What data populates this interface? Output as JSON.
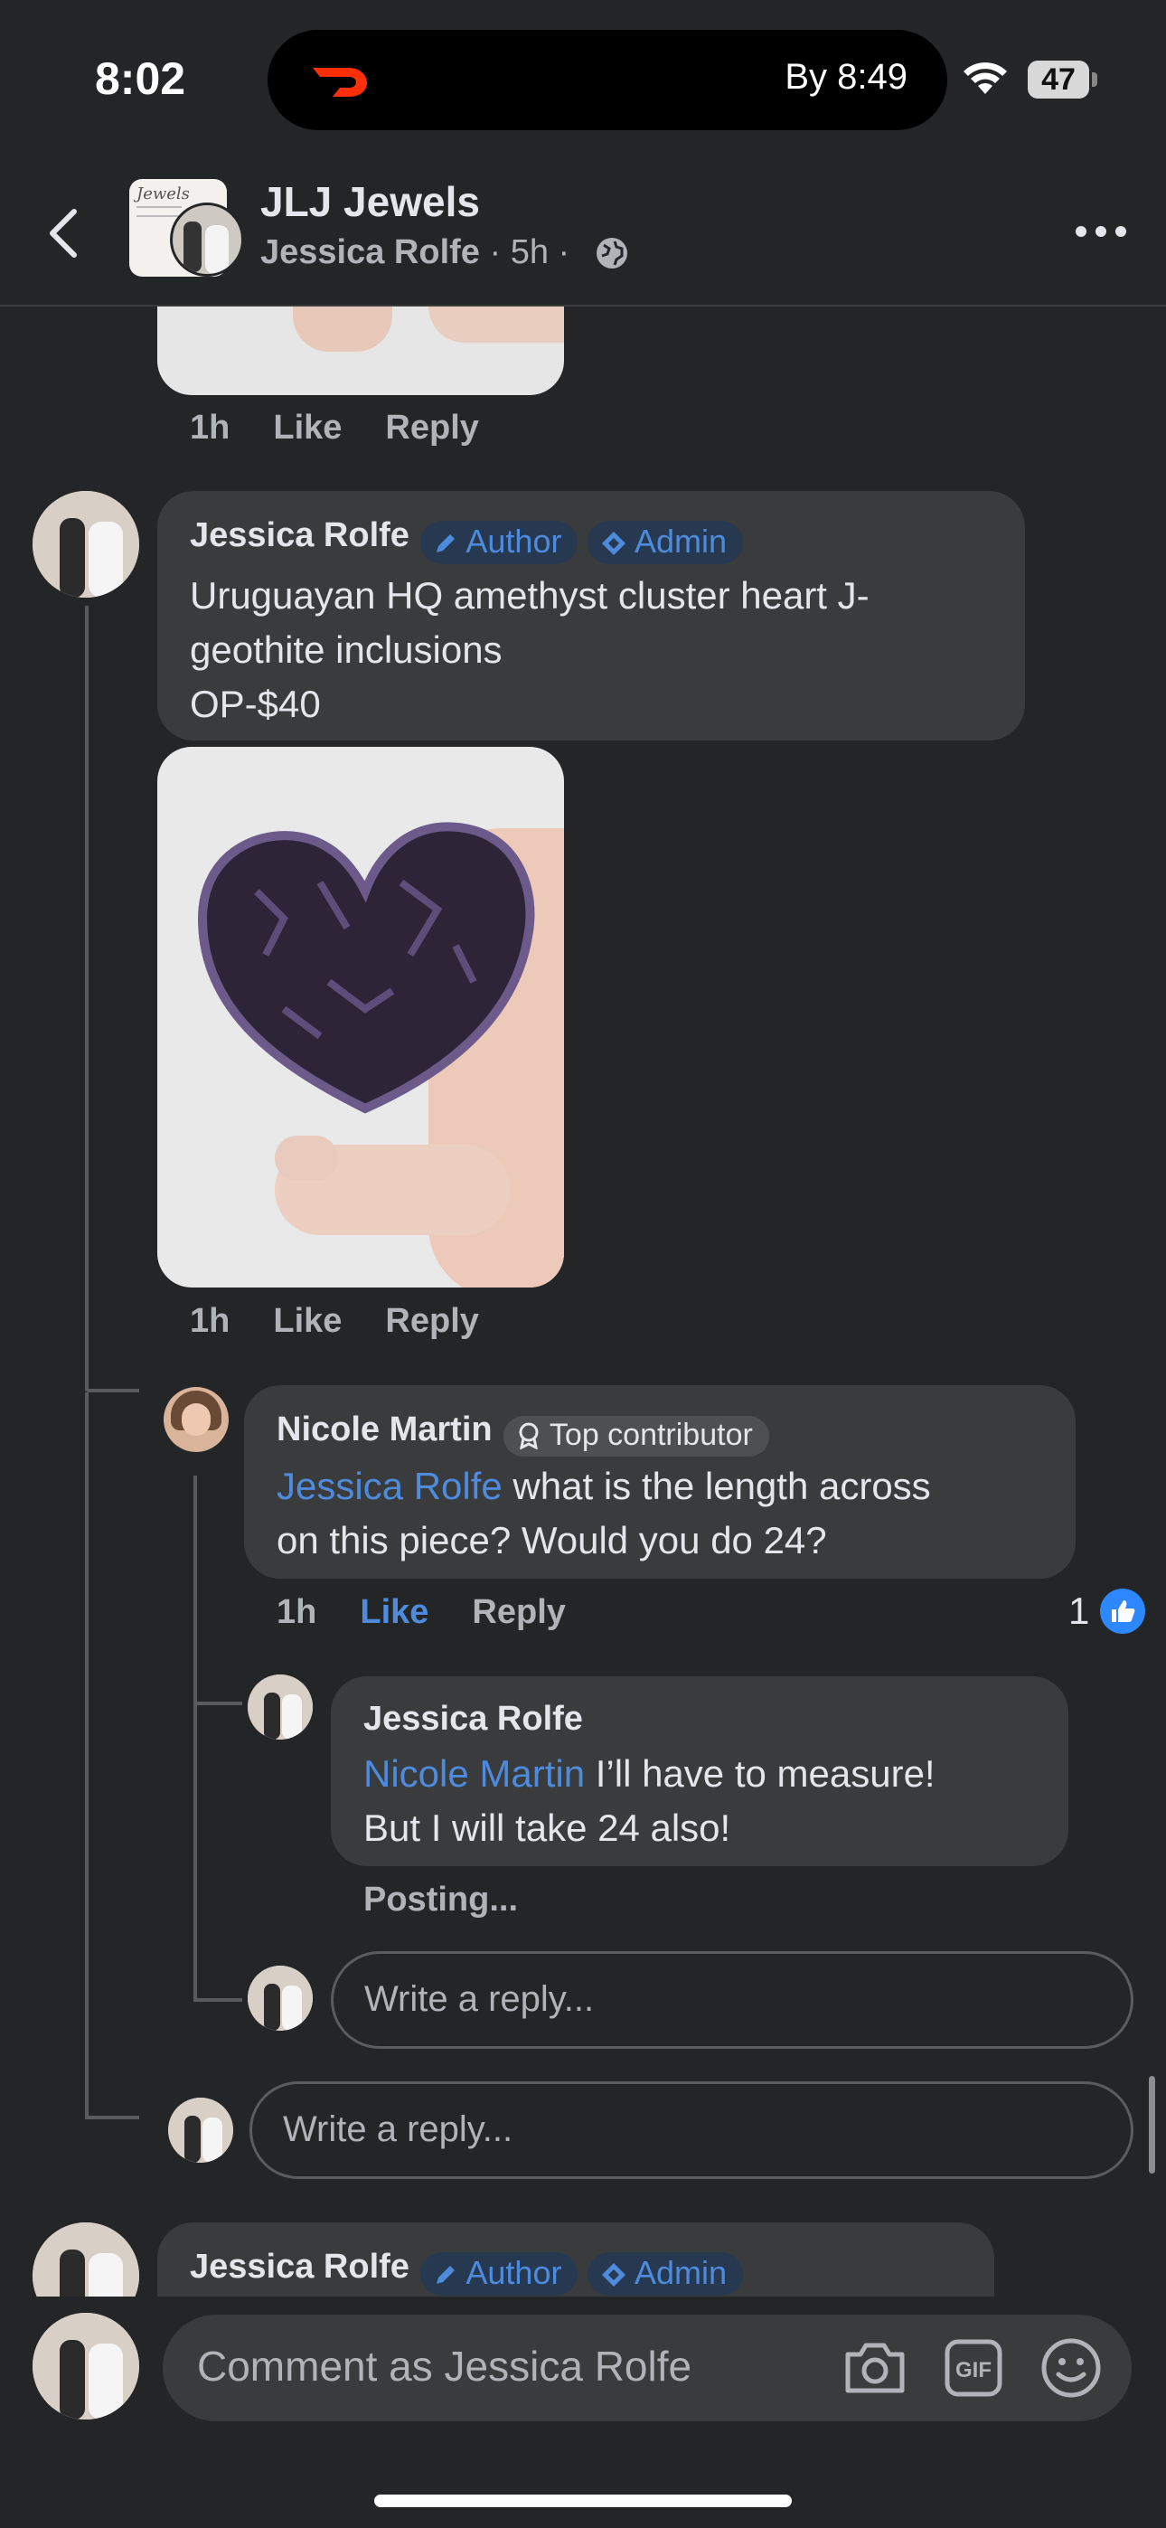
{
  "status": {
    "time": "8:02",
    "eta": "By 8:49",
    "battery": "47"
  },
  "header": {
    "group_name": "JLJ Jewels",
    "author": "Jessica Rolfe",
    "time": "5h"
  },
  "top_comment_actions": {
    "time": "1h",
    "like": "Like",
    "reply": "Reply"
  },
  "main_comment": {
    "author": "Jessica Rolfe",
    "badge_author": "Author",
    "badge_admin": "Admin",
    "text_line1": "Uruguayan HQ amethyst cluster heart J-",
    "text_line2": "geothite inclusions",
    "text_line3": "OP-$40",
    "time": "1h",
    "like": "Like",
    "reply": "Reply"
  },
  "reply1": {
    "author": "Nicole Martin",
    "badge": "Top contributor",
    "mention": "Jessica Rolfe",
    "text_line1": " what is the length across",
    "text_line2": "on this piece? Would you do 24?",
    "time": "1h",
    "like": "Like",
    "reply": "Reply",
    "reactions": "1"
  },
  "reply2": {
    "author": "Jessica Rolfe",
    "mention": "Nicole Martin",
    "text_line1": " I’ll have to measure!",
    "text_line2": "But I will take 24 also!",
    "status": "Posting..."
  },
  "reply_input_nested": {
    "placeholder": "Write a reply..."
  },
  "reply_input_thread": {
    "placeholder": "Write a reply..."
  },
  "next_comment": {
    "author": "Jessica Rolfe",
    "badge_author": "Author",
    "badge_admin": "Admin"
  },
  "composer": {
    "placeholder": "Comment as Jessica Rolfe"
  },
  "colors": {
    "background": "#242526",
    "bubble": "#3a3b3c",
    "link": "#4e8bdd",
    "like_active": "#2d88ff"
  }
}
